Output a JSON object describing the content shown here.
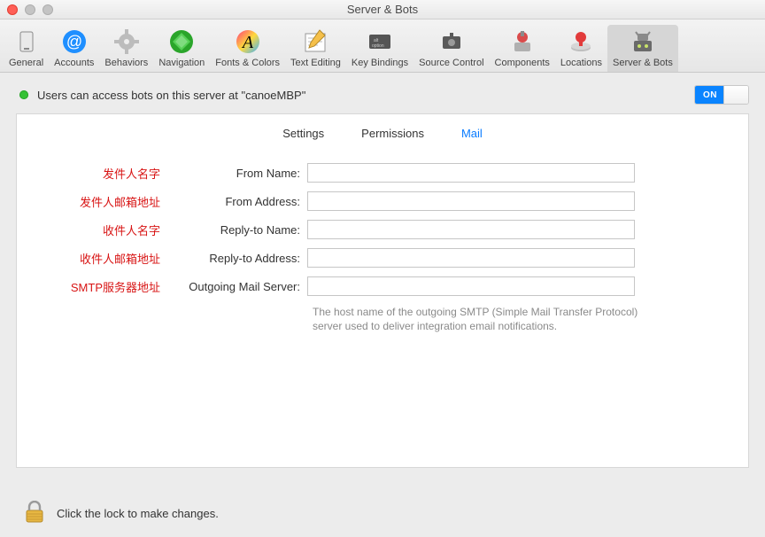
{
  "window": {
    "title": "Server & Bots"
  },
  "toolbar": {
    "items": [
      {
        "id": "general",
        "label": "General"
      },
      {
        "id": "accounts",
        "label": "Accounts"
      },
      {
        "id": "behaviors",
        "label": "Behaviors"
      },
      {
        "id": "navigation",
        "label": "Navigation"
      },
      {
        "id": "fonts-colors",
        "label": "Fonts & Colors"
      },
      {
        "id": "text-editing",
        "label": "Text Editing"
      },
      {
        "id": "key-bindings",
        "label": "Key Bindings"
      },
      {
        "id": "source-control",
        "label": "Source Control"
      },
      {
        "id": "components",
        "label": "Components"
      },
      {
        "id": "locations",
        "label": "Locations"
      },
      {
        "id": "server-bots",
        "label": "Server & Bots",
        "selected": true
      }
    ]
  },
  "status": {
    "text": "Users can access bots on this server at \"canoeMBP\"",
    "switch_label": "ON",
    "switch_on": true
  },
  "tabs": {
    "items": [
      {
        "id": "settings",
        "label": "Settings"
      },
      {
        "id": "permissions",
        "label": "Permissions"
      },
      {
        "id": "mail",
        "label": "Mail",
        "active": true
      }
    ]
  },
  "form": {
    "rows": [
      {
        "annotation": "发件人名字",
        "label": "From Name:",
        "value": ""
      },
      {
        "annotation": "发件人邮箱地址",
        "label": "From Address:",
        "value": ""
      },
      {
        "annotation": "收件人名字",
        "label": "Reply-to Name:",
        "value": ""
      },
      {
        "annotation": "收件人邮箱地址",
        "label": "Reply-to Address:",
        "value": ""
      },
      {
        "annotation": "SMTP服务器地址",
        "label": "Outgoing Mail Server:",
        "value": ""
      }
    ],
    "help": "The host name of the outgoing SMTP (Simple Mail Transfer Protocol) server used to deliver integration email notifications."
  },
  "footer": {
    "lock_text": "Click the lock to make changes."
  }
}
